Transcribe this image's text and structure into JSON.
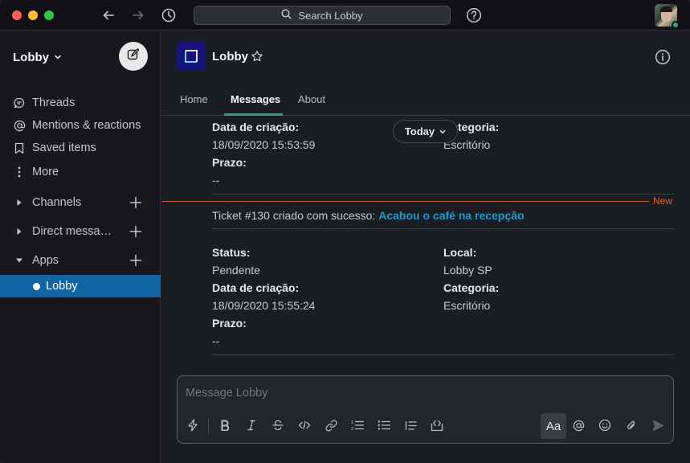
{
  "titlebar": {
    "search_placeholder": "Search Lobby"
  },
  "sidebar": {
    "workspace_name": "Lobby",
    "items": [
      {
        "label": "Threads",
        "icon": "threads-icon"
      },
      {
        "label": "Mentions & reactions",
        "icon": "at-icon"
      },
      {
        "label": "Saved items",
        "icon": "bookmark-icon"
      },
      {
        "label": "More",
        "icon": "more-vertical-icon"
      }
    ],
    "sections": [
      {
        "label": "Channels"
      },
      {
        "label": "Direct messa…"
      },
      {
        "label": "Apps"
      }
    ],
    "active_app": "Lobby"
  },
  "channel": {
    "title": "Lobby",
    "tabs": [
      {
        "label": "Home"
      },
      {
        "label": "Messages"
      },
      {
        "label": "About"
      }
    ]
  },
  "messages": {
    "today_pill": "Today",
    "new_label": "New",
    "first_ticket": {
      "created_label": "Data de criação:",
      "created_value": "18/09/2020 15:53:59",
      "deadline_label": "Prazo:",
      "deadline_value": "--",
      "category_label": "Categoria:",
      "category_value": "Escritório"
    },
    "second_ticket": {
      "intro": "Ticket #130 criado com sucesso: ",
      "link": "Acabou o café na recepção",
      "status_label": "Status:",
      "status_value": "Pendente",
      "local_label": "Local:",
      "local_value": "Lobby SP",
      "created_label": "Data de criação:",
      "created_value": "18/09/2020 15:55:24",
      "category_label": "Categoria:",
      "category_value": "Escritório",
      "deadline_label": "Prazo:",
      "deadline_value": "--"
    }
  },
  "composer": {
    "placeholder": "Message Lobby",
    "format_button": "Aa"
  }
}
